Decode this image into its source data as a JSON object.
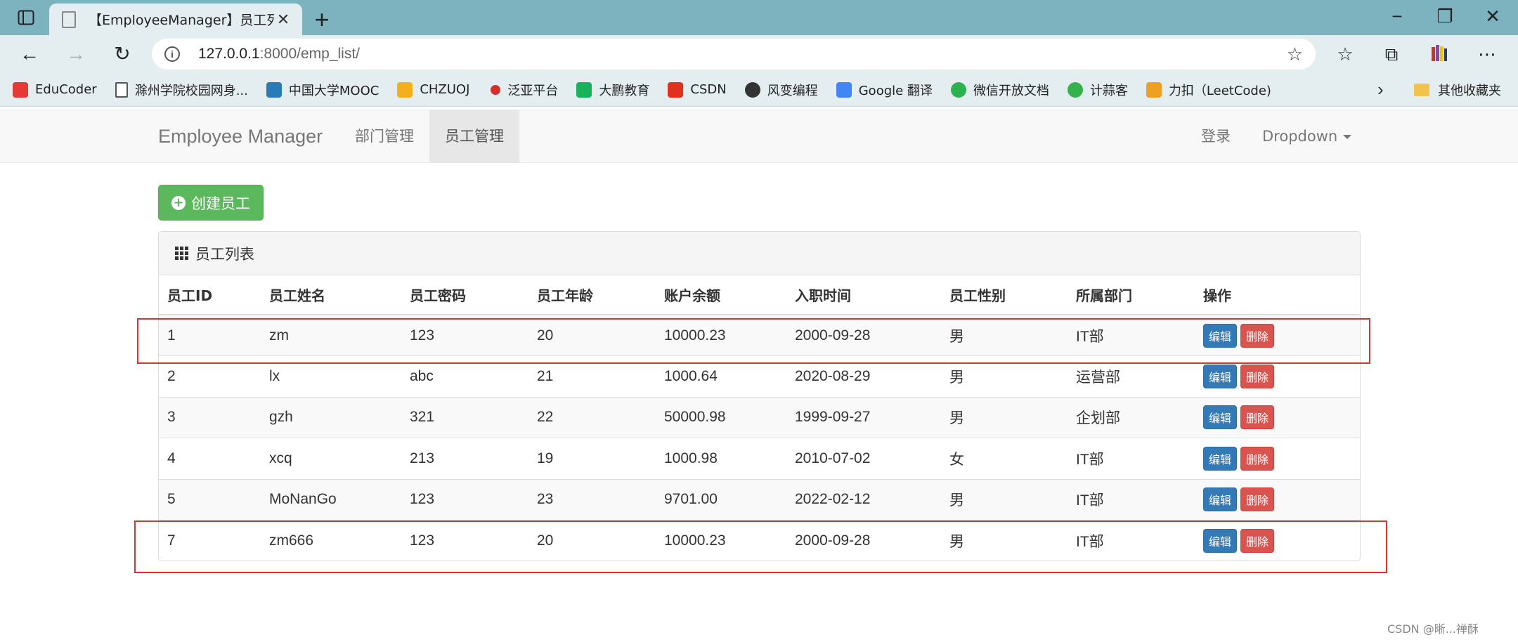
{
  "browser": {
    "tab_title": "【EmployeeManager】员工列表",
    "url_host": "127.0.0.1",
    "url_rest": ":8000/emp_list/",
    "bookmarks": [
      {
        "label": "EduCoder",
        "color": "#e53935"
      },
      {
        "label": "滁州学院校园网身...",
        "color": "#ffffff"
      },
      {
        "label": "中国大学MOOC",
        "color": "#2a7ab8"
      },
      {
        "label": "CHZUOJ",
        "color": "#f2b01e"
      },
      {
        "label": "泛亚平台",
        "color": "#d62d2d"
      },
      {
        "label": "大鹏教育",
        "color": "#17b35b"
      },
      {
        "label": "CSDN",
        "color": "#e0301e"
      },
      {
        "label": "风变编程",
        "color": "#333333"
      },
      {
        "label": "Google 翻译",
        "color": "#4285f4"
      },
      {
        "label": "微信开放文档",
        "color": "#2bb24c"
      },
      {
        "label": "计蒜客",
        "color": "#36b24a"
      },
      {
        "label": "力扣（LeetCode)",
        "color": "#f0a020"
      }
    ],
    "other_bookmarks": "其他收藏夹"
  },
  "navbar": {
    "brand": "Employee Manager",
    "items": [
      {
        "label": "部门管理"
      },
      {
        "label": "员工管理"
      }
    ],
    "login": "登录",
    "dropdown": "Dropdown"
  },
  "create_button": "创建员工",
  "panel_title": "员工列表",
  "table": {
    "headers": [
      "员工ID",
      "员工姓名",
      "员工密码",
      "员工年龄",
      "账户余额",
      "入职时间",
      "员工性别",
      "所属部门",
      "操作"
    ],
    "rows": [
      [
        "1",
        "zm",
        "123",
        "20",
        "10000.23",
        "2000-09-28",
        "男",
        "IT部"
      ],
      [
        "2",
        "lx",
        "abc",
        "21",
        "1000.64",
        "2020-08-29",
        "男",
        "运营部"
      ],
      [
        "3",
        "gzh",
        "321",
        "22",
        "50000.98",
        "1999-09-27",
        "男",
        "企划部"
      ],
      [
        "4",
        "xcq",
        "213",
        "19",
        "1000.98",
        "2010-07-02",
        "女",
        "IT部"
      ],
      [
        "5",
        "MoNanGo",
        "123",
        "23",
        "9701.00",
        "2022-02-12",
        "男",
        "IT部"
      ],
      [
        "7",
        "zm666",
        "123",
        "20",
        "10000.23",
        "2000-09-28",
        "男",
        "IT部"
      ]
    ],
    "edit_label": "编辑",
    "delete_label": "删除"
  },
  "watermark": "CSDN @晰...禅酥"
}
